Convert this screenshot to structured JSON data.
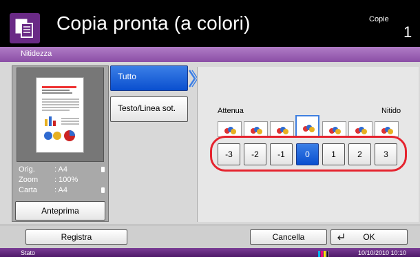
{
  "header": {
    "title": "Copia pronta (a colori)",
    "copies_label": "Copie",
    "copies_value": "1",
    "icon": "copy-icon"
  },
  "tab": {
    "label": "Nitidezza"
  },
  "preview": {
    "info": [
      {
        "key": "Orig.",
        "value": ": A4"
      },
      {
        "key": "Zoom",
        "value": ": 100%"
      },
      {
        "key": "Carta",
        "value": ": A4"
      }
    ],
    "button_label": "Anteprima"
  },
  "modes": {
    "all": "Tutto",
    "text_line": "Testo/Linea sot."
  },
  "sharpness": {
    "left_label": "Attenua",
    "right_label": "Nitido",
    "levels": [
      "-3",
      "-2",
      "-1",
      "0",
      "1",
      "2",
      "3"
    ],
    "selected": "0",
    "accent_color": "#0a4fcf",
    "highlight_color": "#e5232e"
  },
  "footer": {
    "registra": "Registra",
    "cancella": "Cancella",
    "ok": "OK"
  },
  "status": {
    "label": "Stato",
    "datetime": "10/10/2010  10:10"
  }
}
